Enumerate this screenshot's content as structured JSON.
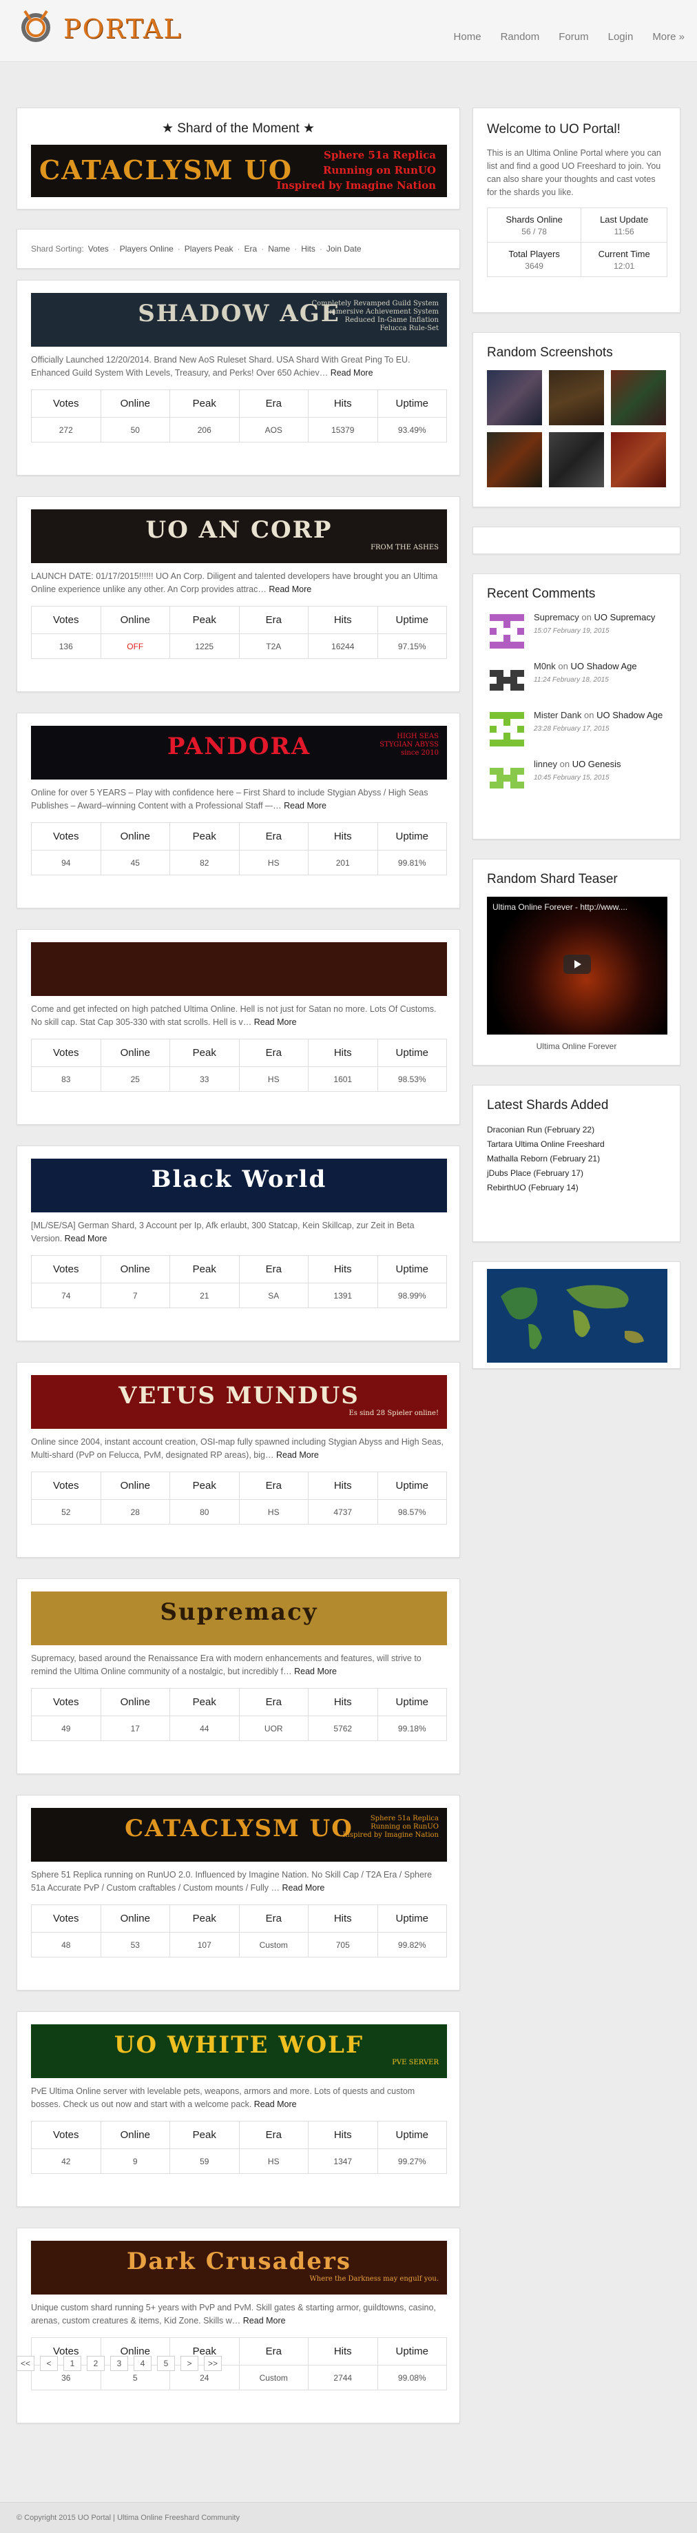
{
  "header": {
    "logo_text": "PORTAL",
    "nav": [
      "Home",
      "Random",
      "Forum",
      "Login",
      "More »"
    ]
  },
  "shard_of_moment": {
    "title": "★  Shard of the Moment  ★",
    "banner_text": "CATACLYSM UO",
    "banner_tagline": [
      "Sphere 51a Replica",
      "Running on RunUO",
      "Inspired by Imagine Nation"
    ]
  },
  "sorting": {
    "label": "Shard Sorting:",
    "options": [
      "Votes",
      "Players Online",
      "Players Peak",
      "Era",
      "Name",
      "Hits",
      "Join Date"
    ]
  },
  "stat_headers": [
    "Votes",
    "Online",
    "Peak",
    "Era",
    "Hits",
    "Uptime"
  ],
  "read_more": "Read More",
  "shards": [
    {
      "banner": "SHADOW AGE",
      "banner_sub": [
        "Completely Revamped Guild System",
        "Immersive Achievement System",
        "Reduced In-Game Inflation",
        "Felucca Rule-Set"
      ],
      "desc": "Officially Launched 12/20/2014. Brand New AoS Ruleset Shard. USA Shard With Great Ping To EU. Enhanced Guild System With Levels, Treasury, and Perks! Over 650 Achiev…",
      "stats": [
        "272",
        "50",
        "206",
        "AOS",
        "15379",
        "93.49%"
      ],
      "colors": {
        "bg": "#1e2b36",
        "fg": "#d6d2c2"
      }
    },
    {
      "banner": "UO AN CORP",
      "banner_sub": [
        "FROM THE ASHES"
      ],
      "desc": "LAUNCH DATE: 01/17/2015!!!!!! UO An Corp. Diligent and talented developers have brought you an Ultima Online experience unlike any other. An Corp provides attrac…",
      "stats": [
        "136",
        "OFF",
        "1225",
        "T2A",
        "16244",
        "97.15%"
      ],
      "colors": {
        "bg": "#1a1412",
        "fg": "#e9e2d0"
      }
    },
    {
      "banner": "PANDORA",
      "banner_sub": [
        "HIGH SEAS",
        "STYGIAN ABYSS",
        "since 2010"
      ],
      "desc": "Online for over 5 YEARS – Play with confidence here – First Shard to include Stygian Abyss / High Seas Publishes – Award–winning Content with a Professional Staff –-…",
      "stats": [
        "94",
        "45",
        "82",
        "HS",
        "201",
        "99.81%"
      ],
      "colors": {
        "bg": "#0c0c10",
        "fg": "#e3182b"
      }
    },
    {
      "banner": "",
      "banner_sub": [],
      "desc": "Come and get infected on high patched Ultima Online. Hell is not just for Satan no more. Lots Of Customs. No skill cap. Stat Cap 305-330 with stat scrolls. Hell is v…",
      "stats": [
        "83",
        "25",
        "33",
        "HS",
        "1601",
        "98.53%"
      ],
      "colors": {
        "bg": "#3a140a",
        "fg": "#d08a30"
      }
    },
    {
      "banner": "Black World",
      "banner_sub": [],
      "desc": "[ML/SE/SA] German Shard, 3 Account per Ip, Afk erlaubt, 300 Statcap, Kein Skillcap, zur Zeit in Beta Version.",
      "stats": [
        "74",
        "7",
        "21",
        "SA",
        "1391",
        "98.99%"
      ],
      "colors": {
        "bg": "#0d1d3e",
        "fg": "#ffffff"
      }
    },
    {
      "banner": "VETUS MUNDUS",
      "banner_sub": [
        "Es sind 28 Spieler online!"
      ],
      "desc": "Online since 2004, instant account creation, OSI-map fully spawned including Stygian Abyss and High Seas, Multi-shard (PvP on Felucca, PvM, designated RP areas), big…",
      "stats": [
        "52",
        "28",
        "80",
        "HS",
        "4737",
        "98.57%"
      ],
      "colors": {
        "bg": "#7a0e0e",
        "fg": "#f0e8d0"
      }
    },
    {
      "banner": "Supremacy",
      "banner_sub": [],
      "desc": "Supremacy, based around the Renaissance Era with modern enhancements and features, will strive to remind the Ultima Online community of a nostalgic, but incredibly f…",
      "stats": [
        "49",
        "17",
        "44",
        "UOR",
        "5762",
        "99.18%"
      ],
      "colors": {
        "bg": "#b38a2e",
        "fg": "#2a1a06"
      }
    },
    {
      "banner": "CATACLYSM UO",
      "banner_sub": [
        "Sphere 51a Replica",
        "Running on RunUO",
        "Inspired by Imagine Nation"
      ],
      "desc": "Sphere 51 Replica running on RunUO 2.0. Influenced by Imagine Nation. No Skill Cap / T2A Era / Sphere 51a Accurate PvP / Custom craftables / Custom mounts / Fully …",
      "stats": [
        "48",
        "53",
        "107",
        "Custom",
        "705",
        "99.82%"
      ],
      "colors": {
        "bg": "#120f0c",
        "fg": "#e0951e"
      }
    },
    {
      "banner": "UO WHITE WOLF",
      "banner_sub": [
        "PVE SERVER"
      ],
      "desc": "PvE Ultima Online server with levelable pets, weapons, armors and more. Lots of quests and custom bosses. Check us out now and start with a welcome pack.",
      "stats": [
        "42",
        "9",
        "59",
        "HS",
        "1347",
        "99.27%"
      ],
      "colors": {
        "bg": "#0f3d14",
        "fg": "#f0c020"
      }
    },
    {
      "banner": "Dark Crusaders",
      "banner_sub": [
        "Where the Darkness may engulf you."
      ],
      "desc": "Unique custom shard running 5+ years with PvP and PvM. Skill gates & starting armor, guildtowns, casino, arenas, custom creatures & items, Kid Zone. Skills w…",
      "stats": [
        "36",
        "5",
        "24",
        "Custom",
        "2744",
        "99.08%"
      ],
      "colors": {
        "bg": "#3a1608",
        "fg": "#e8a040"
      }
    }
  ],
  "pagination": [
    "<<",
    "<",
    "1",
    "2",
    "3",
    "4",
    "5",
    ">",
    ">>"
  ],
  "welcome": {
    "title": "Welcome to UO Portal!",
    "text": "This is an Ultima Online Portal where you can list and find a good UO Freeshard to join. You can also share your thoughts and cast votes for the shards you like.",
    "stats": [
      {
        "label": "Shards Online",
        "value": "56 / 78"
      },
      {
        "label": "Last Update",
        "value": "11:56"
      },
      {
        "label": "Total Players",
        "value": "3649"
      },
      {
        "label": "Current Time",
        "value": "12:01"
      }
    ]
  },
  "screenshots": {
    "title": "Random Screenshots"
  },
  "recent_comments": {
    "title": "Recent Comments",
    "on": "on",
    "items": [
      {
        "who": "Supremacy",
        "where": "UO Supremacy",
        "when": "15:07 February 19, 2015",
        "color": "#b05cc0"
      },
      {
        "who": "M0nk",
        "where": "UO Shadow Age",
        "when": "11:24 February 18, 2015",
        "color": "#3a3a3a"
      },
      {
        "who": "Mister Dank",
        "where": "UO Shadow Age",
        "when": "23:28 February 17, 2015",
        "color": "#7ac232"
      },
      {
        "who": "linney",
        "where": "UO Genesis",
        "when": "10:45 February 15, 2015",
        "color": "#88c84a"
      }
    ]
  },
  "teaser": {
    "title": "Random Shard Teaser",
    "video_title": "Ultima Online Forever - http://www....",
    "caption": "Ultima Online Forever"
  },
  "latest": {
    "title": "Latest Shards Added",
    "items": [
      "Draconian Run (February 22)",
      "Tartara Ultima Online Freeshard",
      "Mathalla Reborn (February 21)",
      "jDubs Place (February 17)",
      "RebirthUO (February 14)"
    ]
  },
  "footer": {
    "text": "© Copyright 2015 UO Portal | Ultima Online Freeshard Community"
  }
}
